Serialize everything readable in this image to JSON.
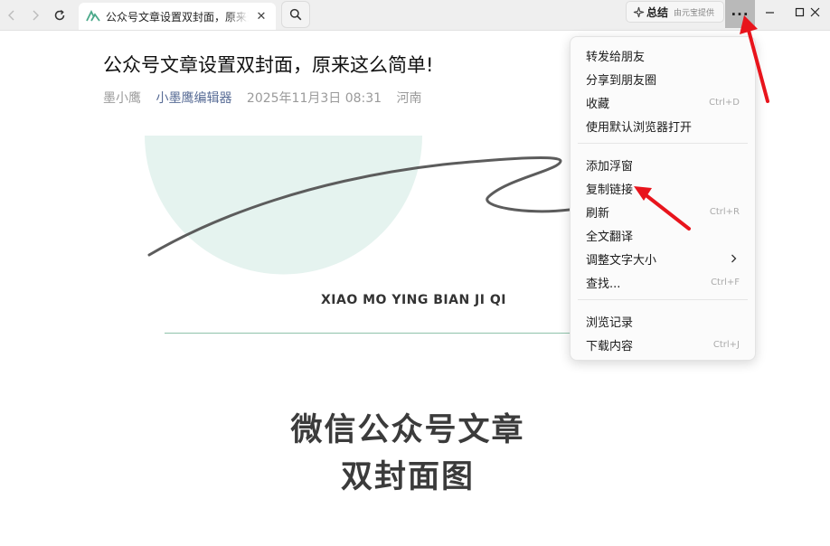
{
  "browser": {
    "tab_title": "公众号文章设置双封面，原来这么简单",
    "summary_label": "总结",
    "summary_sub": "由元宝提供",
    "more_label": "···"
  },
  "article": {
    "title": "公众号文章设置双封面，原来这么简单!",
    "author": "墨小鹰",
    "account": "小墨鹰编辑器",
    "datetime": "2025年11月3日 08:31",
    "location": "河南",
    "cover_caption": "XIAO MO YING BIAN JI QI",
    "big_title_line1": "微信公众号文章",
    "big_title_line2": "双封面图"
  },
  "menu": {
    "items": [
      {
        "label": "转发给朋友",
        "shortcut": ""
      },
      {
        "label": "分享到朋友圈",
        "shortcut": ""
      },
      {
        "label": "收藏",
        "shortcut": "Ctrl+D"
      },
      {
        "label": "使用默认浏览器打开",
        "shortcut": ""
      },
      {
        "label": "添加浮窗",
        "shortcut": ""
      },
      {
        "label": "复制链接",
        "shortcut": ""
      },
      {
        "label": "刷新",
        "shortcut": "Ctrl+R"
      },
      {
        "label": "全文翻译",
        "shortcut": ""
      },
      {
        "label": "调整文字大小",
        "shortcut": ""
      },
      {
        "label": "查找...",
        "shortcut": "Ctrl+F"
      },
      {
        "label": "浏览记录",
        "shortcut": ""
      },
      {
        "label": "下载内容",
        "shortcut": "Ctrl+J"
      }
    ]
  },
  "colors": {
    "accent_green": "#4aa98a",
    "cover_circle": "#e5f3ef",
    "annotation_arrow": "#e8141c",
    "account_link": "#576b95"
  }
}
